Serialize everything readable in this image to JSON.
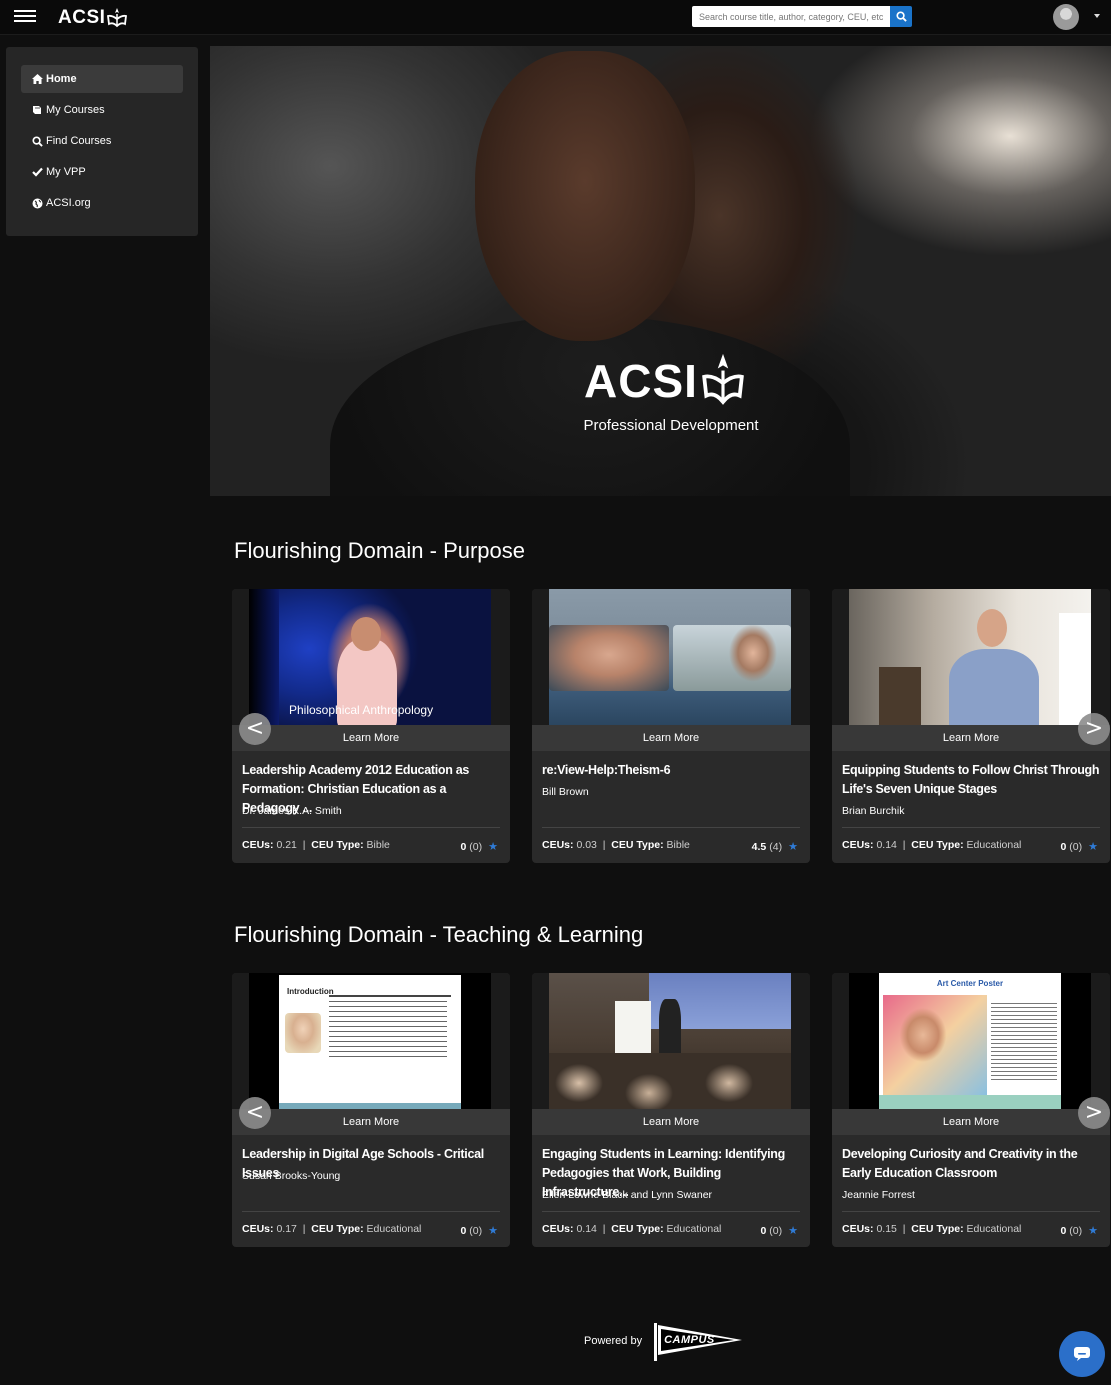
{
  "brand": {
    "name": "ACSI"
  },
  "search": {
    "placeholder": "Search course title, author, category, CEU, etc"
  },
  "sidebar": {
    "items": [
      {
        "label": "Home",
        "icon": "home-icon",
        "active": true
      },
      {
        "label": "My Courses",
        "icon": "book-icon",
        "active": false
      },
      {
        "label": "Find Courses",
        "icon": "search-icon",
        "active": false
      },
      {
        "label": "My VPP",
        "icon": "check-icon",
        "active": false
      },
      {
        "label": "ACSI.org",
        "icon": "globe-icon",
        "active": false
      }
    ]
  },
  "hero": {
    "logo_text": "ACSI",
    "subtitle": "Professional Development"
  },
  "sections": [
    {
      "title": "Flourishing Domain - Purpose",
      "cards": [
        {
          "thumb_caption": "Philosophical Anthropology",
          "learn_more": "Learn More",
          "title": "Leadership Academy 2012 Education as Formation: Christian Education as a Pedagogy ...",
          "author": "Dr. James K.A. Smith",
          "ceus_label": "CEUs:",
          "ceus": "0.21",
          "ceu_type_label": "CEU Type:",
          "ceu_type": "Bible",
          "rating": "0",
          "rating_count": "(0)"
        },
        {
          "thumb_caption": "",
          "learn_more": "Learn More",
          "title": "re:View-Help:Theism-6",
          "author": "Bill Brown",
          "ceus_label": "CEUs:",
          "ceus": "0.03",
          "ceu_type_label": "CEU Type:",
          "ceu_type": "Bible",
          "rating": "4.5",
          "rating_count": "(4)"
        },
        {
          "thumb_caption": "",
          "learn_more": "Learn More",
          "title": "Equipping Students to Follow Christ Through Life's Seven Unique Stages",
          "author": "Brian Burchik",
          "ceus_label": "CEUs:",
          "ceus": "0.14",
          "ceu_type_label": "CEU Type:",
          "ceu_type": "Educational",
          "rating": "0",
          "rating_count": "(0)"
        }
      ]
    },
    {
      "title": "Flourishing Domain - Teaching & Learning",
      "cards": [
        {
          "thumb_caption": "Introduction",
          "learn_more": "Learn More",
          "title": "Leadership in Digital Age Schools - Critical Issues",
          "author": "Susan Brooks-Young",
          "ceus_label": "CEUs:",
          "ceus": "0.17",
          "ceu_type_label": "CEU Type:",
          "ceu_type": "Educational",
          "rating": "0",
          "rating_count": "(0)"
        },
        {
          "thumb_caption": "",
          "learn_more": "Learn More",
          "title": "Engaging Students in Learning: Identifying Pedagogies that Work, Building Infrastructure...",
          "author": "Ellen Lowrie Black and Lynn Swaner",
          "ceus_label": "CEUs:",
          "ceus": "0.14",
          "ceu_type_label": "CEU Type:",
          "ceu_type": "Educational",
          "rating": "0",
          "rating_count": "(0)"
        },
        {
          "thumb_caption": "Art Center Poster",
          "learn_more": "Learn More",
          "title": "Developing Curiosity and Creativity in the Early Education Classroom",
          "author": "Jeannie Forrest",
          "ceus_label": "CEUs:",
          "ceus": "0.15",
          "ceu_type_label": "CEU Type:",
          "ceu_type": "Educational",
          "rating": "0",
          "rating_count": "(0)"
        }
      ]
    }
  ],
  "carousel": {
    "prev": "<",
    "next": ">"
  },
  "footer": {
    "powered_by": "Powered by",
    "campus_logo": "CAMPUS"
  },
  "colors": {
    "accent": "#1a73c9",
    "star": "#2f7bd6",
    "card_bg": "#2a2a2a",
    "page_bg": "#0f0f0f"
  }
}
